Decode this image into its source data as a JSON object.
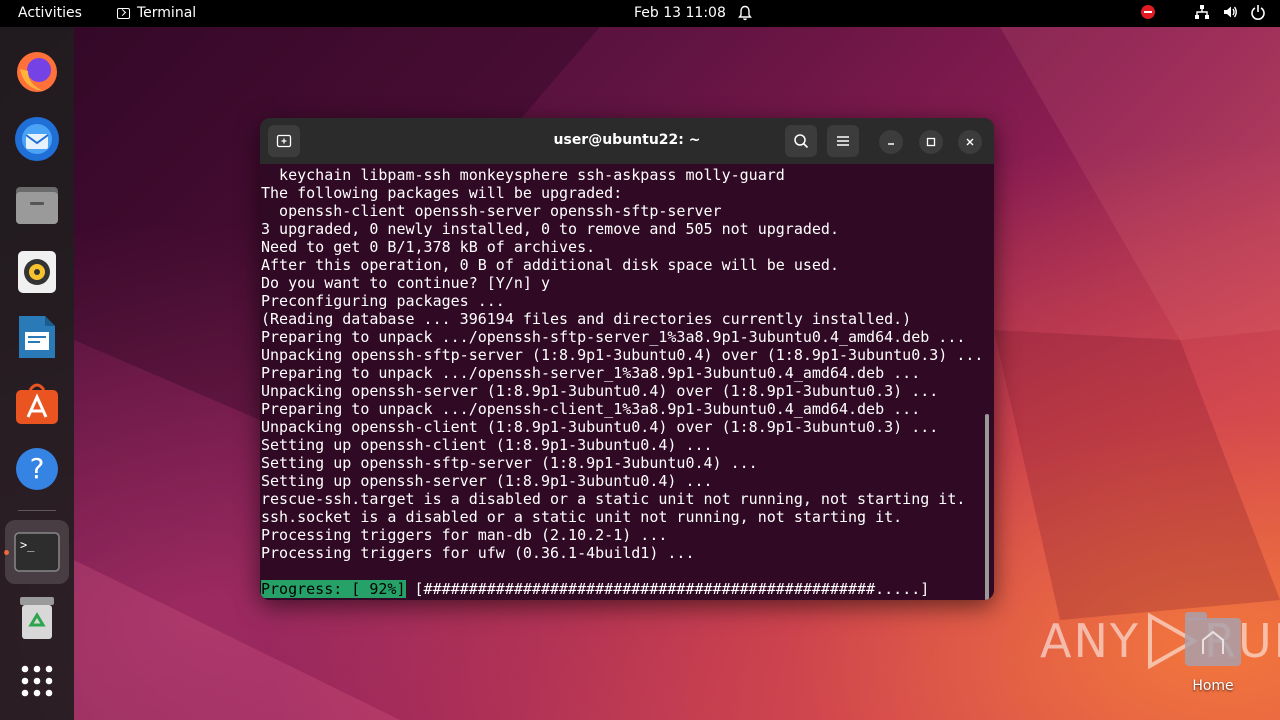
{
  "topbar": {
    "activities_label": "Activities",
    "app_name": "Terminal",
    "clock": "Feb 13  11:08",
    "icons": [
      "bell-icon",
      "do-not-disturb-icon",
      "network-icon",
      "volume-icon",
      "power-icon"
    ]
  },
  "dock": {
    "items": [
      {
        "name": "firefox",
        "icon": "firefox-icon"
      },
      {
        "name": "thunderbird",
        "icon": "thunderbird-icon"
      },
      {
        "name": "files",
        "icon": "files-icon"
      },
      {
        "name": "rhythmbox",
        "icon": "rhythmbox-icon"
      },
      {
        "name": "libreoffice-writer",
        "icon": "writer-icon"
      },
      {
        "name": "ubuntu-software",
        "icon": "software-icon"
      },
      {
        "name": "help",
        "icon": "help-icon",
        "glyph": "?"
      },
      {
        "name": "terminal",
        "icon": "terminal-icon",
        "glyph": ">_",
        "active": true
      },
      {
        "name": "trash",
        "icon": "trash-icon"
      },
      {
        "name": "show-applications",
        "icon": "app-grid-icon"
      }
    ]
  },
  "window": {
    "title": "user@ubuntu22: ~",
    "lines": [
      "  keychain libpam-ssh monkeysphere ssh-askpass molly-guard",
      "The following packages will be upgraded:",
      "  openssh-client openssh-server openssh-sftp-server",
      "3 upgraded, 0 newly installed, 0 to remove and 505 not upgraded.",
      "Need to get 0 B/1,378 kB of archives.",
      "After this operation, 0 B of additional disk space will be used.",
      "Do you want to continue? [Y/n] y",
      "Preconfiguring packages ...",
      "(Reading database ... 396194 files and directories currently installed.)",
      "Preparing to unpack .../openssh-sftp-server_1%3a8.9p1-3ubuntu0.4_amd64.deb ...",
      "Unpacking openssh-sftp-server (1:8.9p1-3ubuntu0.4) over (1:8.9p1-3ubuntu0.3) ...",
      "Preparing to unpack .../openssh-server_1%3a8.9p1-3ubuntu0.4_amd64.deb ...",
      "Unpacking openssh-server (1:8.9p1-3ubuntu0.4) over (1:8.9p1-3ubuntu0.3) ...",
      "Preparing to unpack .../openssh-client_1%3a8.9p1-3ubuntu0.4_amd64.deb ...",
      "Unpacking openssh-client (1:8.9p1-3ubuntu0.4) over (1:8.9p1-3ubuntu0.3) ...",
      "Setting up openssh-client (1:8.9p1-3ubuntu0.4) ...",
      "Setting up openssh-sftp-server (1:8.9p1-3ubuntu0.4) ...",
      "Setting up openssh-server (1:8.9p1-3ubuntu0.4) ...",
      "rescue-ssh.target is a disabled or a static unit not running, not starting it.",
      "ssh.socket is a disabled or a static unit not running, not starting it.",
      "Processing triggers for man-db (2.10.2-1) ...",
      "Processing triggers for ufw (0.36.1-4build1) ...",
      ""
    ],
    "progress_label": "Progress: [ 92%]",
    "progress_bar": " [##################################################.....]",
    "progress_percent": 92
  },
  "desktop": {
    "home_label": "Home",
    "watermark_left": "ANY",
    "watermark_right": "RUN"
  },
  "colors": {
    "terminal_bg": "#300a24",
    "titlebar_bg": "#2b2b2b",
    "progress_green": "#26a269",
    "ubuntu_orange": "#e95420"
  }
}
